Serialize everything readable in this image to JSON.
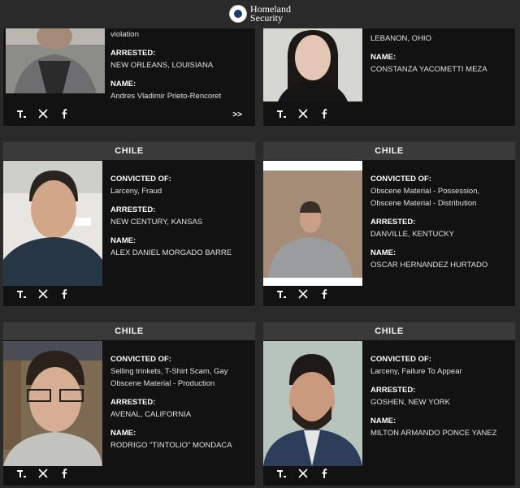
{
  "header": {
    "logo_line1": "Homeland",
    "logo_line2": "Security"
  },
  "labels": {
    "convicted": "CONVICTED OF:",
    "arrested": "ARRESTED:",
    "name": "NAME:"
  },
  "more_label": ">>",
  "cards": [
    {
      "country": "",
      "convicted": "violation",
      "arrested": "NEW ORLEANS, LOUISIANA",
      "name": "Andres Vladimir Prieto-Rencoret"
    },
    {
      "country": "",
      "arrested": "LEBANON, OHIO",
      "name": "CONSTANZA YACOMETTI MEZA"
    },
    {
      "country": "CHILE",
      "convicted": "Larceny, Fraud",
      "arrested": "NEW CENTURY, KANSAS",
      "name": "ALEX DANIEL MORGADO BARRE"
    },
    {
      "country": "CHILE",
      "convicted": "Obscene Material - Possession, Obscene Material - Distribution",
      "arrested": "DANVILLE, KENTUCKY",
      "name": "OSCAR HERNANDEZ HURTADO"
    },
    {
      "country": "CHILE",
      "convicted": "Selling trinkets, T-Shirt Scam, Gay Obscene Material - Production",
      "arrested": "AVENAL, CALIFORNIA",
      "name": "RODRIGO \"TINTOLIO\" MONDACA"
    },
    {
      "country": "CHILE",
      "convicted": "Larceny, Failure To Appear",
      "arrested": "GOSHEN, NEW YORK",
      "name": "MILTON ARMANDO PONCE YANEZ"
    }
  ]
}
